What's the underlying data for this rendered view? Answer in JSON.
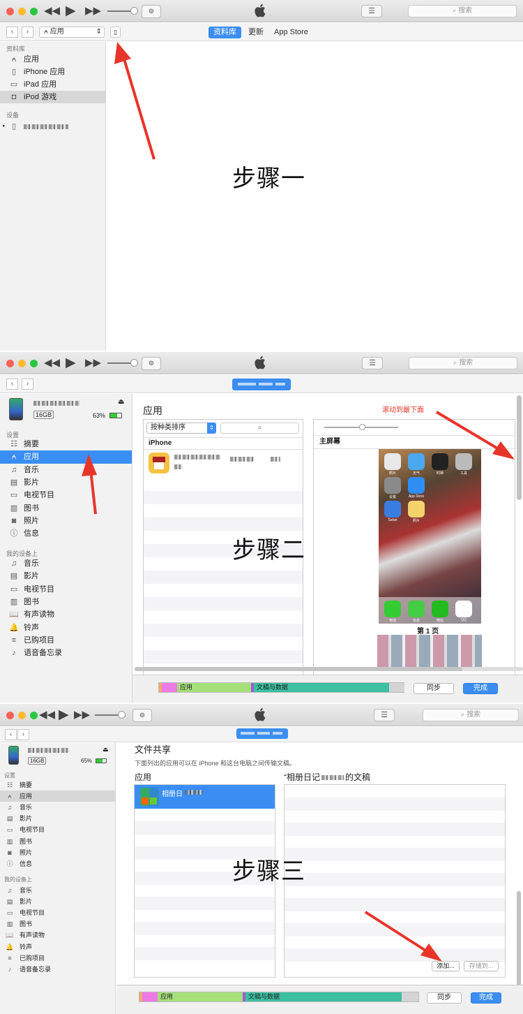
{
  "toolbar": {
    "search_placeholder": "搜索",
    "apple_icon": "apple-logo",
    "list_icon": "☰",
    "airplay_icon": "▭"
  },
  "step1": {
    "nav_select": "应用",
    "tabs": [
      "资料库",
      "更新",
      "App Store"
    ],
    "library_header": "资料库",
    "library_items": [
      "应用",
      "iPhone 应用",
      "iPad 应用",
      "iPod 游戏"
    ],
    "device_header": "设备",
    "step_label": "步骤一"
  },
  "step2": {
    "device_capacity": "16GB",
    "battery": "63%",
    "settings_header": "设置",
    "settings_items": [
      "摘要",
      "应用",
      "音乐",
      "影片",
      "电视节目",
      "图书",
      "照片",
      "信息"
    ],
    "on_device_header": "我的设备上",
    "on_device_items": [
      "音乐",
      "影片",
      "电视节目",
      "图书",
      "有声读物",
      "铃声",
      "已购项目",
      "语音备忘录"
    ],
    "apps_title": "应用",
    "sort_select": "按种类排序",
    "list_header": "iPhone",
    "scroll_hint": "滚动到最下面",
    "home_screen": "主屏幕",
    "page_label": "第 1 页",
    "storage_apps": "应用",
    "storage_docs": "文稿与数据",
    "sync": "同步",
    "done": "完成",
    "step_label": "步骤二",
    "home_apps": [
      "照片",
      "天气",
      "时钟",
      "工具",
      "设置",
      "App Store",
      "",
      "",
      "Safari",
      "照片",
      "",
      ""
    ],
    "dock_apps": [
      "电话",
      "信息",
      "微信",
      "QQ"
    ]
  },
  "step3": {
    "device_capacity": "16GB",
    "battery": "65%",
    "settings_header": "设置",
    "settings_items": [
      "摘要",
      "应用",
      "音乐",
      "影片",
      "电视节目",
      "图书",
      "照片",
      "信息"
    ],
    "on_device_header": "我的设备上",
    "on_device_items": [
      "音乐",
      "影片",
      "电视节目",
      "图书",
      "有声读物",
      "铃声",
      "已购项目",
      "语音备忘录"
    ],
    "title": "文件共享",
    "description": "下面列出的应用可以在 iPhone 和这台电脑之间传输文稿。",
    "apps_header": "应用",
    "app_name": "相册日",
    "docs_header_prefix": "“相册日记",
    "docs_header_suffix": "的文稿",
    "add": "添加...",
    "save": "存储到...",
    "storage_apps": "应用",
    "storage_docs": "文稿与数据",
    "sync": "同步",
    "done": "完成",
    "step_label": "步骤三"
  },
  "colors": {
    "accent": "#3b8ef0",
    "arrow": "#e8352a",
    "storage_pink": "#ee7ae6",
    "storage_green": "#a5e07a",
    "storage_teal": "#3cc0a0",
    "storage_gray": "#d4d4d4"
  }
}
